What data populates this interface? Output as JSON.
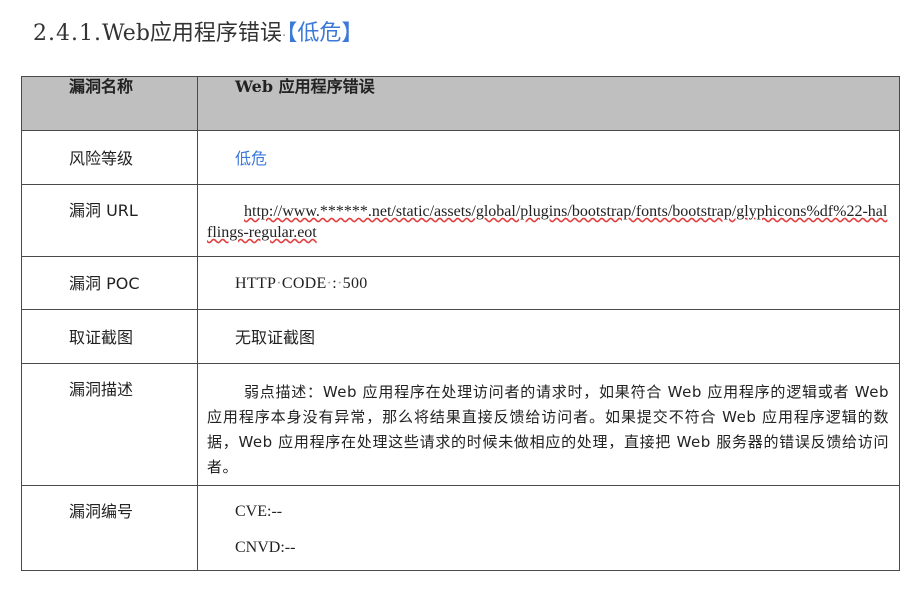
{
  "heading": {
    "number": "2.4.1.",
    "title": "Web应用程序错误",
    "level": "【低危】"
  },
  "colors": {
    "accent": "#3b78d8",
    "header_bg": "#bfbfbf",
    "border": "#4a4a4a",
    "spellcheck_underline": "#e04040"
  },
  "table": {
    "header": {
      "label": "漏洞名称",
      "value": "Web 应用程序错误"
    },
    "rows": [
      {
        "label": "风险等级",
        "value": "低危"
      },
      {
        "label": "漏洞 URL",
        "value": "http://www.******.net/static/assets/global/plugins/bootstrap/fonts/bootstrap/glyphicons%df%22-halflings-regular.eot"
      },
      {
        "label": "漏洞 POC",
        "value_parts": [
          "HTTP",
          "CODE",
          ":",
          "500"
        ]
      },
      {
        "label": "取证截图",
        "value": "无取证截图"
      },
      {
        "label": "漏洞描述",
        "value": "弱点描述：Web 应用程序在处理访问者的请求时，如果符合 Web 应用程序的逻辑或者 Web 应用程序本身没有异常，那么将结果直接反馈给访问者。如果提交不符合 Web 应用程序逻辑的数据，Web 应用程序在处理这些请求的时候未做相应的处理，直接把 Web 服务器的错误反馈给访问者。"
      },
      {
        "label": "漏洞编号",
        "values": [
          "CVE:--",
          "CNVD:--"
        ]
      }
    ]
  }
}
